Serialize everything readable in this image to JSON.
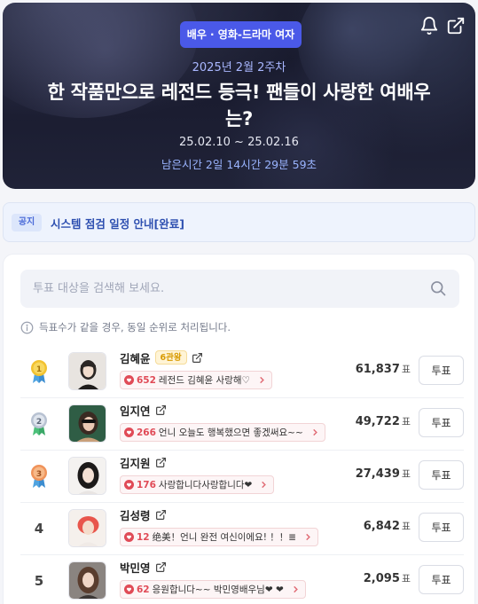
{
  "hero": {
    "category": "배우 · 영화-드라마 여자",
    "week": "2025년 2월 2주차",
    "title": "한 작품만으로 레전드 등극! 팬들이 사랑한 여배우는?",
    "period": "25.02.10 ~ 25.02.16",
    "remaining": "남은시간 2일 14시간 29분 59초",
    "icons": [
      "bell-icon",
      "share-icon"
    ]
  },
  "notice": {
    "tag": "공지",
    "text": "시스템 점검 일정 안내[완료]"
  },
  "search": {
    "placeholder": "투표 대상을 검색해 보세요."
  },
  "info_text": "득표수가 같을 경우, 동일 순위로 처리됩니다.",
  "rankings": [
    {
      "rank": "1",
      "medal": "gold",
      "name": "김혜윤",
      "badge": "6관왕",
      "comment_count": "652",
      "comment": "레전드 김혜윤 사랑해♡",
      "votes": "61,837",
      "unit": "표",
      "vote_label": "투표"
    },
    {
      "rank": "2",
      "medal": "silver",
      "name": "임지연",
      "badge": "",
      "comment_count": "266",
      "comment": "언니 오늘도 행복했으면 좋겠써요~~",
      "votes": "49,722",
      "unit": "표",
      "vote_label": "투표"
    },
    {
      "rank": "3",
      "medal": "bronze",
      "name": "김지원",
      "badge": "",
      "comment_count": "176",
      "comment": "사랑합니다사랑합니다❤",
      "votes": "27,439",
      "unit": "표",
      "vote_label": "투표"
    },
    {
      "rank": "4",
      "medal": "",
      "name": "김성령",
      "badge": "",
      "comment_count": "12",
      "comment": "绝美！언니 완전 여신이에요! ！！≣",
      "votes": "6,842",
      "unit": "표",
      "vote_label": "투표"
    },
    {
      "rank": "5",
      "medal": "",
      "name": "박민영",
      "badge": "",
      "comment_count": "62",
      "comment": "응원합니다~~ 박민영배우님❤ ❤",
      "votes": "2,095",
      "unit": "표",
      "vote_label": "투표"
    }
  ],
  "colors": {
    "accent": "#4a59e8",
    "gold": "#f2c230",
    "silver": "#a9b4c6",
    "bronze": "#f0935a",
    "heart": "#e04b57"
  }
}
